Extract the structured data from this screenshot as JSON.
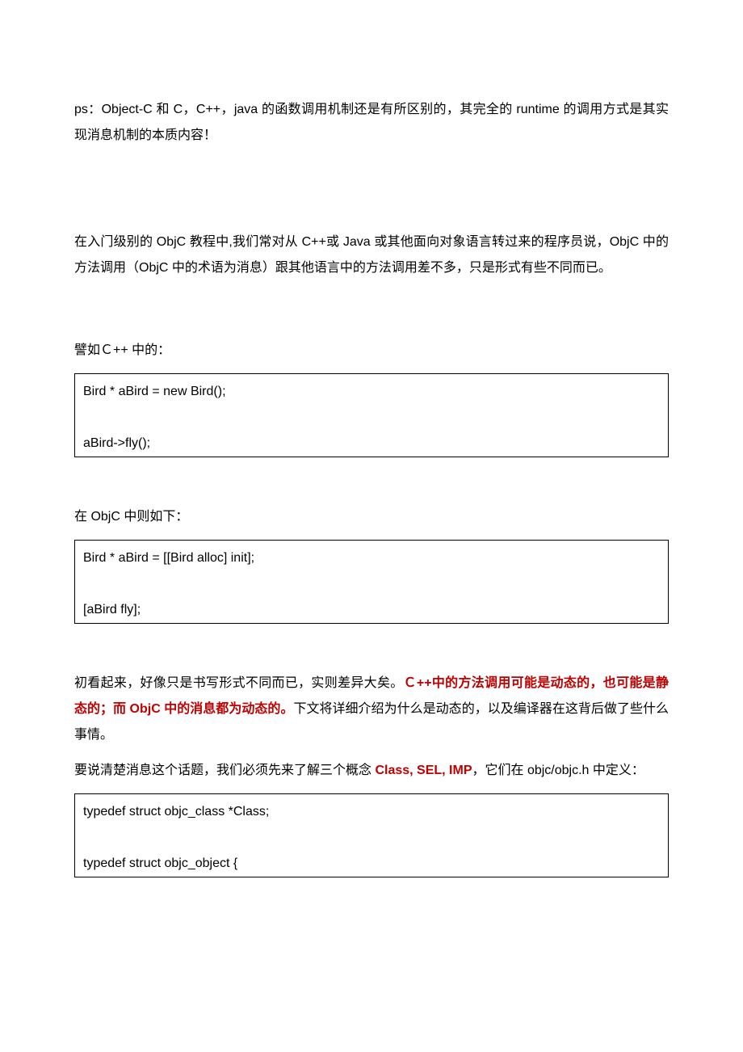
{
  "para1_a": "ps：Object-C 和 C，C++，java 的函数调用机制还是有所区别的，其完全的 runtime 的调用方式是其实现消息机制的本质内容！",
  "para2": "在入门级别的 ObjC  教程中,我们常对从 C++或 Java  或其他面向对象语言转过来的程序员说，ObjC  中的方法调用（ObjC 中的术语为消息）跟其他语言中的方法调用差不多，只是形式有些不同而已。",
  "para3": "譬如Ｃ++  中的：",
  "code1": "Bird * aBird = new Bird();\n\naBird->fly();",
  "para4": "在 ObjC  中则如下：",
  "code2": "Bird * aBird = [[Bird alloc] init];\n\n[aBird fly];",
  "para5_a": "初看起来，好像只是书写形式不同而已，实则差异大矣。",
  "para5_red": "Ｃ++中的方法调用可能是动态的，也可能是静态的；而 ObjC 中的消息都为动态的。",
  "para5_b": "下文将详细介绍为什么是动态的，以及编译器在这背后做了些什么事情。",
  "para6_a": "要说清楚消息这个话题，我们必须先来了解三个概念 ",
  "para6_red": "Class, SEL, IMP",
  "para6_b": "，它们在 objc/objc.h  中定义：",
  "code3": "typedef struct objc_class *Class;\n\ntypedef struct objc_object {"
}
